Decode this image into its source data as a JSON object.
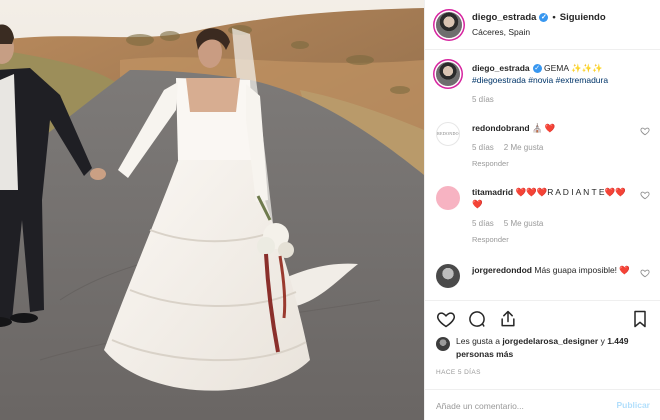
{
  "post": {
    "username": "diego_estrada",
    "follow_status": "Siguiendo",
    "location": "Cáceres, Spain",
    "separator": "•"
  },
  "comments": [
    {
      "user": "diego_estrada",
      "text": "GEMA ✨✨✨",
      "hashtags": "#diegoestrada #novia #extremadura",
      "time": "5 días",
      "avatar": "owner-avatar"
    },
    {
      "user": "redondobrand",
      "text": "⛪ ❤️",
      "time": "5 días",
      "likes": "2 Me gusta",
      "reply": "Responder",
      "avatar_text": "REDONDO BRAND"
    },
    {
      "user": "titamadrid",
      "text": "❤️❤️❤️R A D I A N T E❤️❤️❤️",
      "time": "5 días",
      "likes": "5 Me gusta",
      "reply": "Responder"
    },
    {
      "user": "jorgeredondod",
      "text": "Más guapa imposible! ❤️"
    }
  ],
  "actions": {
    "like_icon": "heart-icon",
    "comment_icon": "comment-icon",
    "share_icon": "share-icon",
    "save_icon": "bookmark-icon"
  },
  "likes": {
    "prefix": "Les gusta a ",
    "user": "jorgedelarosa_designer",
    "middle": " y ",
    "count": "1.449 personas más"
  },
  "posted_ago": "HACE 5 DÍAS",
  "comment_box": {
    "placeholder": "Añade un comentario...",
    "publish_label": "Publicar"
  },
  "colors": {
    "verified": "#3897f0",
    "hashtag": "#003569",
    "publish_disabled": "#b2dffc",
    "heart": "#ed4956"
  }
}
